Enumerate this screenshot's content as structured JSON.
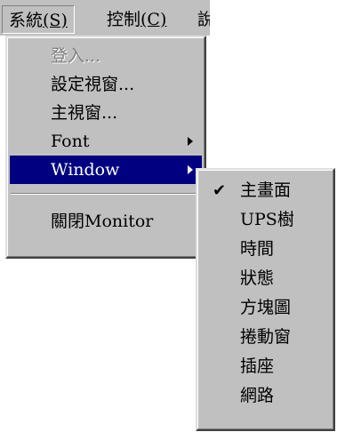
{
  "menubar": {
    "system_label": "系統",
    "system_mnemonic": "(S)",
    "control_label": "控制",
    "control_mnemonic": "(C)",
    "third_partial": "說"
  },
  "system_menu": {
    "items": [
      {
        "label": "登入...",
        "disabled": true
      },
      {
        "label": "設定視窗...",
        "disabled": false
      },
      {
        "label": "主視窗...",
        "disabled": false
      },
      {
        "label": "Font",
        "has_submenu": true
      },
      {
        "label": "Window",
        "has_submenu": true,
        "highlighted": true
      },
      {
        "label": "關閉Monitor",
        "disabled": false
      }
    ]
  },
  "window_submenu": {
    "items": [
      {
        "label": "主畫面",
        "checked": true
      },
      {
        "label": "UPS樹"
      },
      {
        "label": "時間"
      },
      {
        "label": "狀態"
      },
      {
        "label": "方塊圖"
      },
      {
        "label": "捲動窗"
      },
      {
        "label": "插座"
      },
      {
        "label": "網路"
      }
    ],
    "check_glyph": "✔"
  },
  "colors": {
    "menu_bg": "#c0c0c0",
    "highlight_bg": "#000080",
    "highlight_text": "#ffffff",
    "disabled_text": "#808080"
  }
}
